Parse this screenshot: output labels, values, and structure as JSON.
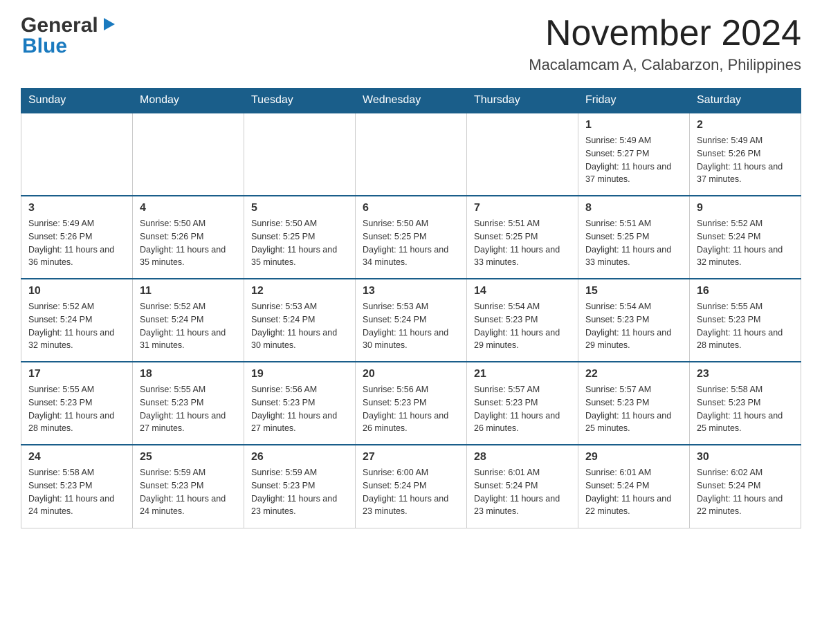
{
  "header": {
    "logo": {
      "general": "General",
      "arrow_note": "blue arrow triangle",
      "blue": "Blue"
    },
    "title": "November 2024",
    "location": "Macalamcam A, Calabarzon, Philippines"
  },
  "calendar": {
    "days_of_week": [
      "Sunday",
      "Monday",
      "Tuesday",
      "Wednesday",
      "Thursday",
      "Friday",
      "Saturday"
    ],
    "weeks": [
      [
        {
          "day": "",
          "info": ""
        },
        {
          "day": "",
          "info": ""
        },
        {
          "day": "",
          "info": ""
        },
        {
          "day": "",
          "info": ""
        },
        {
          "day": "",
          "info": ""
        },
        {
          "day": "1",
          "info": "Sunrise: 5:49 AM\nSunset: 5:27 PM\nDaylight: 11 hours and 37 minutes."
        },
        {
          "day": "2",
          "info": "Sunrise: 5:49 AM\nSunset: 5:26 PM\nDaylight: 11 hours and 37 minutes."
        }
      ],
      [
        {
          "day": "3",
          "info": "Sunrise: 5:49 AM\nSunset: 5:26 PM\nDaylight: 11 hours and 36 minutes."
        },
        {
          "day": "4",
          "info": "Sunrise: 5:50 AM\nSunset: 5:26 PM\nDaylight: 11 hours and 35 minutes."
        },
        {
          "day": "5",
          "info": "Sunrise: 5:50 AM\nSunset: 5:25 PM\nDaylight: 11 hours and 35 minutes."
        },
        {
          "day": "6",
          "info": "Sunrise: 5:50 AM\nSunset: 5:25 PM\nDaylight: 11 hours and 34 minutes."
        },
        {
          "day": "7",
          "info": "Sunrise: 5:51 AM\nSunset: 5:25 PM\nDaylight: 11 hours and 33 minutes."
        },
        {
          "day": "8",
          "info": "Sunrise: 5:51 AM\nSunset: 5:25 PM\nDaylight: 11 hours and 33 minutes."
        },
        {
          "day": "9",
          "info": "Sunrise: 5:52 AM\nSunset: 5:24 PM\nDaylight: 11 hours and 32 minutes."
        }
      ],
      [
        {
          "day": "10",
          "info": "Sunrise: 5:52 AM\nSunset: 5:24 PM\nDaylight: 11 hours and 32 minutes."
        },
        {
          "day": "11",
          "info": "Sunrise: 5:52 AM\nSunset: 5:24 PM\nDaylight: 11 hours and 31 minutes."
        },
        {
          "day": "12",
          "info": "Sunrise: 5:53 AM\nSunset: 5:24 PM\nDaylight: 11 hours and 30 minutes."
        },
        {
          "day": "13",
          "info": "Sunrise: 5:53 AM\nSunset: 5:24 PM\nDaylight: 11 hours and 30 minutes."
        },
        {
          "day": "14",
          "info": "Sunrise: 5:54 AM\nSunset: 5:23 PM\nDaylight: 11 hours and 29 minutes."
        },
        {
          "day": "15",
          "info": "Sunrise: 5:54 AM\nSunset: 5:23 PM\nDaylight: 11 hours and 29 minutes."
        },
        {
          "day": "16",
          "info": "Sunrise: 5:55 AM\nSunset: 5:23 PM\nDaylight: 11 hours and 28 minutes."
        }
      ],
      [
        {
          "day": "17",
          "info": "Sunrise: 5:55 AM\nSunset: 5:23 PM\nDaylight: 11 hours and 28 minutes."
        },
        {
          "day": "18",
          "info": "Sunrise: 5:55 AM\nSunset: 5:23 PM\nDaylight: 11 hours and 27 minutes."
        },
        {
          "day": "19",
          "info": "Sunrise: 5:56 AM\nSunset: 5:23 PM\nDaylight: 11 hours and 27 minutes."
        },
        {
          "day": "20",
          "info": "Sunrise: 5:56 AM\nSunset: 5:23 PM\nDaylight: 11 hours and 26 minutes."
        },
        {
          "day": "21",
          "info": "Sunrise: 5:57 AM\nSunset: 5:23 PM\nDaylight: 11 hours and 26 minutes."
        },
        {
          "day": "22",
          "info": "Sunrise: 5:57 AM\nSunset: 5:23 PM\nDaylight: 11 hours and 25 minutes."
        },
        {
          "day": "23",
          "info": "Sunrise: 5:58 AM\nSunset: 5:23 PM\nDaylight: 11 hours and 25 minutes."
        }
      ],
      [
        {
          "day": "24",
          "info": "Sunrise: 5:58 AM\nSunset: 5:23 PM\nDaylight: 11 hours and 24 minutes."
        },
        {
          "day": "25",
          "info": "Sunrise: 5:59 AM\nSunset: 5:23 PM\nDaylight: 11 hours and 24 minutes."
        },
        {
          "day": "26",
          "info": "Sunrise: 5:59 AM\nSunset: 5:23 PM\nDaylight: 11 hours and 23 minutes."
        },
        {
          "day": "27",
          "info": "Sunrise: 6:00 AM\nSunset: 5:24 PM\nDaylight: 11 hours and 23 minutes."
        },
        {
          "day": "28",
          "info": "Sunrise: 6:01 AM\nSunset: 5:24 PM\nDaylight: 11 hours and 23 minutes."
        },
        {
          "day": "29",
          "info": "Sunrise: 6:01 AM\nSunset: 5:24 PM\nDaylight: 11 hours and 22 minutes."
        },
        {
          "day": "30",
          "info": "Sunrise: 6:02 AM\nSunset: 5:24 PM\nDaylight: 11 hours and 22 minutes."
        }
      ]
    ]
  }
}
